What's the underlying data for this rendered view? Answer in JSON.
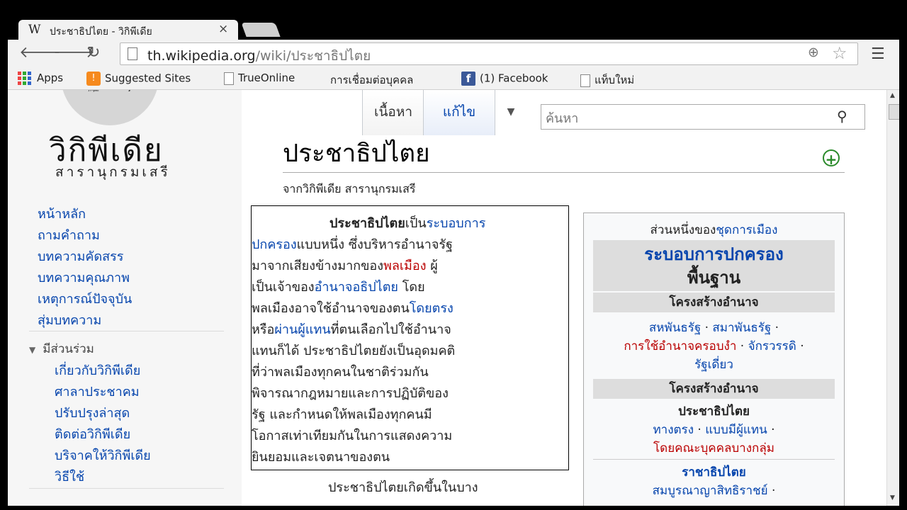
{
  "browser": {
    "tab_title": "ประชาธิปไตย - วิกิพีเดีย",
    "tab_logo": "W",
    "tab_close": "×",
    "url_host": "th.wikipedia.org",
    "url_path": "/wiki/ประชาธิปไตย",
    "bookmarks": [
      {
        "label": "Apps",
        "icon": "apps-grid-icon"
      },
      {
        "label": "Suggested Sites",
        "icon": "bulb-icon"
      },
      {
        "label": "TrueOnline",
        "icon": "page-icon"
      },
      {
        "label": "การเชื่อมต่อบุคคล",
        "icon": "windows-logo-icon"
      },
      {
        "label": "(1) Facebook",
        "icon": "facebook-icon"
      },
      {
        "label": "แท็บใหม่",
        "icon": "page-icon"
      }
    ]
  },
  "sidebar": {
    "site_name": "วิกิพีเดีย",
    "site_tagline": "สารานุกรมเสรี",
    "nav": [
      "หน้าหลัก",
      "ถามคำถาม",
      "บทความคัดสรร",
      "บทความคุณภาพ",
      "เหตุการณ์ปัจจุบัน",
      "สุ่มบทความ"
    ],
    "participate_heading": "มีส่วนร่วม",
    "participate": [
      "เกี่ยวกับวิกิพีเดีย",
      "ศาลาประชาคม",
      "ปรับปรุงล่าสุด",
      "ติดต่อวิกิพีเดีย",
      "บริจาคให้วิกิพีเดีย",
      "วิธีใช้"
    ]
  },
  "article": {
    "tabs": {
      "read": "เนื้อหา",
      "edit": "แก้ไข"
    },
    "search_placeholder": "ค้นหา",
    "title": "ประชาธิปไตย",
    "from": "จากวิกิพีเดีย สารานุกรมเสรี",
    "lead": {
      "b1": "ประชาธิปไตย",
      "t1": "เป็น",
      "l1": "ระบอบการ",
      "l1b": "ปกครอง",
      "t2": "แบบหนึ่ง ซึ่งบริหารอำนาจรัฐ",
      "t3": "มาจากเสียงข้างมากของ",
      "r1": "พลเมือง",
      "t3b": " ผู้",
      "t4": "เป็นเจ้าของ",
      "l2": "อำนาจอธิปไตย",
      "t4b": " โดย",
      "t5": "พลเมืองอาจใช้อำนาจของตน",
      "l3": "โดยตรง",
      "t6": "หรือ",
      "l4": "ผ่านผู้แทน",
      "t6b": "ที่ตนเลือกไปใช้อำนาจ",
      "t7": "แทนก็ได้ ประชาธิปไตยยังเป็นอุดมคติ",
      "t8": "ที่ว่าพลเมืองทุกคนในชาติร่วมกัน",
      "t9": "พิจารณากฎหมายและการปฏิบัติของ",
      "t10": "รัฐ และกำหนดให้พลเมืองทุกคนมี",
      "t11": "โอกาสเท่าเทียมกันในการแสดงความ",
      "t12": "ยินยอมและเจตนาของตน"
    },
    "next_para": "ประชาธิปไตยเกิดขึ้นในบาง"
  },
  "infobox": {
    "part_of_prefix": "ส่วนหนึ่งของ",
    "part_of_link": "ชุดการเมือง",
    "main_link": "ระบอบการปกครอง",
    "main_sub": "พื้นฐาน",
    "sec1": "โครงสร้างอำนาจ",
    "sec1_l1a": "สหพันธรัฐ",
    "sec1_l1b": "สมาพันธรัฐ",
    "sec1_l2a": "การใช้อำนาจครอบงำ",
    "sec1_l2b": "จักรวรรดิ",
    "sec1_l3": "รัฐเดี่ยว",
    "sec2": "โครงสร้างอำนาจ",
    "sec2_sub": "ประชาธิปไตย",
    "sec2_l1a": "ทางตรง",
    "sec2_l1b": "แบบมีผู้แทน",
    "sec2_l2": "โดยคณะบุคคลบางกลุ่ม",
    "sec3": "ราชาธิปไตย",
    "sec3_l1": "สมบูรณาญาสิทธิราชย์",
    "bullet": " · "
  }
}
